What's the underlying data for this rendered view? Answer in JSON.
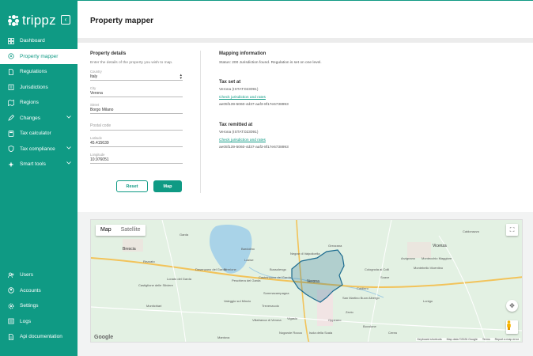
{
  "brand": {
    "name": "trippz",
    "collapse_glyph": "‹"
  },
  "nav": {
    "items": [
      {
        "label": "Dashboard",
        "icon": "dashboard-icon",
        "active": false,
        "chevron": false
      },
      {
        "label": "Property mapper",
        "icon": "map-pin-icon",
        "active": true,
        "chevron": false
      },
      {
        "label": "Regulations",
        "icon": "document-icon",
        "active": false,
        "chevron": false
      },
      {
        "label": "Jurisdictions",
        "icon": "building-icon",
        "active": false,
        "chevron": false
      },
      {
        "label": "Regions",
        "icon": "map-icon",
        "active": false,
        "chevron": false
      },
      {
        "label": "Changes",
        "icon": "edit-icon",
        "active": false,
        "chevron": true
      },
      {
        "label": "Tax calculator",
        "icon": "calculator-icon",
        "active": false,
        "chevron": false
      },
      {
        "label": "Tax compliance",
        "icon": "shield-icon",
        "active": false,
        "chevron": true
      },
      {
        "label": "Smart tools",
        "icon": "sparkle-icon",
        "active": false,
        "chevron": true
      }
    ],
    "bottom_items": [
      {
        "label": "Users",
        "icon": "users-icon"
      },
      {
        "label": "Accounts",
        "icon": "accounts-icon"
      },
      {
        "label": "Settings",
        "icon": "gear-icon"
      },
      {
        "label": "Logs",
        "icon": "logs-icon"
      },
      {
        "label": "Api documentation",
        "icon": "api-doc-icon"
      }
    ]
  },
  "header": {
    "title": "Property mapper"
  },
  "property": {
    "heading": "Property details",
    "helper": "Enter the details of the property you wish to map.",
    "country": {
      "label": "Country",
      "value": "Italy"
    },
    "city": {
      "label": "City",
      "value": "Verona"
    },
    "street": {
      "label": "Street",
      "value": "Borgo Milano"
    },
    "postal": {
      "placeholder": "Postal code"
    },
    "latitude": {
      "label": "Latitude",
      "value": "45.415639"
    },
    "longitude": {
      "label": "Longitude",
      "value": "10.976051"
    },
    "reset_label": "Reset",
    "map_label": "Map"
  },
  "mapping": {
    "heading": "Mapping information",
    "status": "Status: 200 Jurisdiction found. Regulation is set on one level.",
    "tax_set": {
      "heading": "Tax set at",
      "name": "Verona (ISTAT:023091)",
      "link": "Check jurisdiction and rates",
      "id": "ae05f139-5060-4d37-aaf3-8f17e6738993"
    },
    "tax_remitted": {
      "heading": "Tax remitted at",
      "name": "Verona (ISTAT:023091)",
      "link": "Check jurisdiction and rates",
      "id": "ae05f139-5060-4d37-aaf3-8f17e6738993"
    }
  },
  "map": {
    "type_map": "Map",
    "type_satellite": "Satellite",
    "google": "Google",
    "keyboard": "Keyboard shortcuts",
    "map_data": "Map data ©2026 Google",
    "terms": "Terms",
    "report": "Report a map error",
    "places": [
      "Brescia",
      "Verona",
      "Vicenza",
      "Garda",
      "Bardolino",
      "Lazise",
      "Peschiera del Garda",
      "Desenzano del Garda",
      "Sirmione",
      "Bussolengo",
      "Castelnuovo del Garda",
      "Villafranca di Verona",
      "Sommacampagna",
      "San Martino Buon Albergo",
      "Zevio",
      "Soave",
      "Lonigo",
      "Montebello Vicentino",
      "Arzignano",
      "Montecchio Maggiore",
      "Isola della Scala",
      "Nogarole Rocca",
      "Negrar di Valpolicella",
      "Grezzana",
      "Caldiero",
      "Colognola ai Colli",
      "Castiglione delle Stiviere",
      "Lonato del Garda",
      "Mantova",
      "Vigasio",
      "Cerea",
      "Oppeano",
      "Bovolone",
      "Trevenzuolo",
      "Valeggio sul Mincio",
      "Montichiari",
      "Rezzato",
      "Gussago",
      "Caldonazzo"
    ]
  },
  "colors": {
    "brand": "#0f9a84",
    "boundary": "#1c6b8f",
    "water": "#a9d3e8"
  }
}
